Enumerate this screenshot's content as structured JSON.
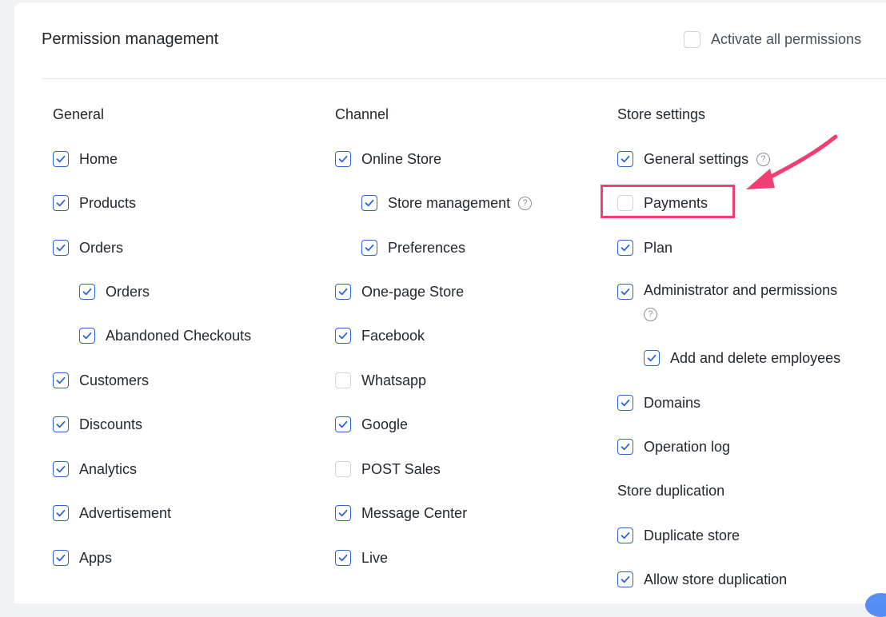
{
  "header": {
    "title": "Permission management",
    "activate_all_label": "Activate all permissions",
    "activate_all_checked": false
  },
  "columns": {
    "general": {
      "title": "General",
      "items": [
        {
          "label": "Home",
          "checked": true
        },
        {
          "label": "Products",
          "checked": true
        },
        {
          "label": "Orders",
          "checked": true
        },
        {
          "label": "Orders",
          "checked": true
        },
        {
          "label": "Abandoned Checkouts",
          "checked": true
        },
        {
          "label": "Customers",
          "checked": true
        },
        {
          "label": "Discounts",
          "checked": true
        },
        {
          "label": "Analytics",
          "checked": true
        },
        {
          "label": "Advertisement",
          "checked": true
        },
        {
          "label": "Apps",
          "checked": true
        }
      ]
    },
    "channel": {
      "title": "Channel",
      "items": [
        {
          "label": "Online Store",
          "checked": true
        },
        {
          "label": "Store management",
          "checked": true
        },
        {
          "label": "Preferences",
          "checked": true
        },
        {
          "label": "One-page Store",
          "checked": true
        },
        {
          "label": "Facebook",
          "checked": true
        },
        {
          "label": "Whatsapp",
          "checked": false
        },
        {
          "label": "Google",
          "checked": true
        },
        {
          "label": "POST Sales",
          "checked": false
        },
        {
          "label": "Message Center",
          "checked": true
        },
        {
          "label": "Live",
          "checked": true
        }
      ]
    },
    "store_settings": {
      "title": "Store settings",
      "items": [
        {
          "label": "General settings",
          "checked": true
        },
        {
          "label": "Payments",
          "checked": false
        },
        {
          "label": "Plan",
          "checked": true
        },
        {
          "label": "Administrator and permissions",
          "checked": true
        },
        {
          "label": "Add and delete employees",
          "checked": true
        },
        {
          "label": "Domains",
          "checked": true
        },
        {
          "label": "Operation log",
          "checked": true
        }
      ]
    },
    "store_duplication": {
      "title": "Store duplication",
      "items": [
        {
          "label": "Duplicate store",
          "checked": true
        },
        {
          "label": "Allow store duplication",
          "checked": true
        }
      ]
    }
  },
  "icons": {
    "help": "question-circle-icon",
    "check": "check-icon"
  },
  "help_glyph": "?",
  "colors": {
    "accent": "#2a64d7",
    "highlight": "#ef3f73"
  }
}
